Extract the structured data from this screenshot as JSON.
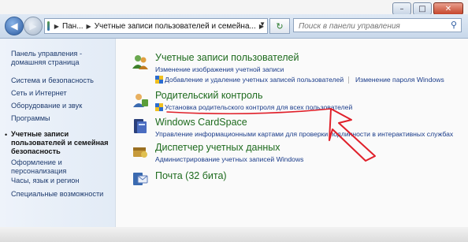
{
  "window": {
    "minimize": "–",
    "maximize": "□",
    "close": "✕"
  },
  "address": {
    "segment_1": "Пан...",
    "segment_2": "Учетные записи пользователей и семейна...",
    "refresh": "↻",
    "search_placeholder": "Поиск в панели управления"
  },
  "sidebar": {
    "items": [
      {
        "label": "Панель управления - домашняя страница"
      },
      {
        "label": "Система и безопасность"
      },
      {
        "label": "Сеть и Интернет"
      },
      {
        "label": "Оборудование и звук"
      },
      {
        "label": "Программы"
      },
      {
        "label": "Учетные записи пользователей и семейная безопасность",
        "current": true
      },
      {
        "label": "Оформление и персонализация"
      },
      {
        "label": "Часы, язык и регион"
      },
      {
        "label": "Специальные возможности"
      }
    ],
    "bullet": "•"
  },
  "categories": [
    {
      "title": "Учетные записи пользователей",
      "links": [
        "Изменение изображения учетной записи",
        "Добавление и удаление учетных записей пользователей",
        "Изменение пароля Windows"
      ]
    },
    {
      "title": "Родительский контроль",
      "links": [
        "Установка родительского контроля для всех пользователей"
      ]
    },
    {
      "title": "Windows CardSpace",
      "links": [
        "Управление информационными картами для проверки подлинности в интерактивных службах"
      ]
    },
    {
      "title": "Диспетчер учетных данных",
      "links": [
        "Администрирование учетных записей Windows"
      ]
    },
    {
      "title": "Почта (32 бита)",
      "links": []
    }
  ],
  "colors": {
    "category_title": "#1e6b1e",
    "link": "#1a3c8a",
    "annotation": "#e0202a"
  }
}
